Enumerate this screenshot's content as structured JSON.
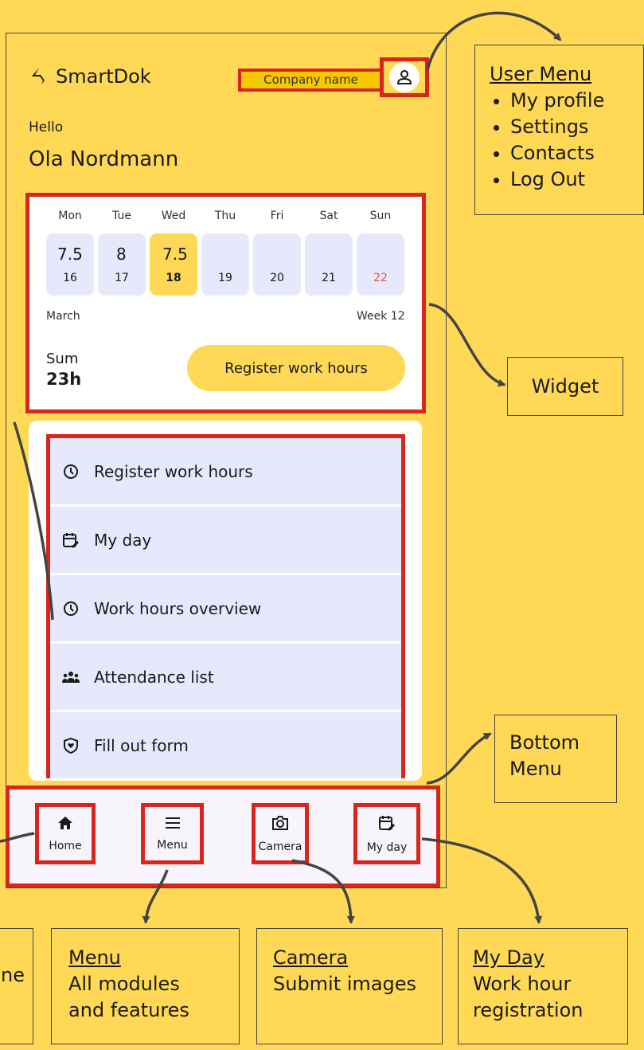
{
  "app": {
    "name": "SmartDok",
    "company": "Company name"
  },
  "greeting": "Hello",
  "user_name": "Ola Nordmann",
  "week": {
    "days": [
      "Mon",
      "Tue",
      "Wed",
      "Thu",
      "Fri",
      "Sat",
      "Sun"
    ],
    "hours": [
      "7.5",
      "8",
      "7.5",
      "",
      "",
      "",
      ""
    ],
    "dates": [
      "16",
      "17",
      "18",
      "19",
      "20",
      "21",
      "22"
    ],
    "month": "March",
    "week_label": "Week 12",
    "sum_label": "Sum",
    "sum_value": "23h",
    "register_button": "Register work hours"
  },
  "modules": [
    {
      "label": "Register work hours",
      "icon": "clock-icon"
    },
    {
      "label": "My day",
      "icon": "calendar-edit-icon"
    },
    {
      "label": "Work hours overview",
      "icon": "clock-icon"
    },
    {
      "label": "Attendance list",
      "icon": "group-icon"
    },
    {
      "label": "Fill out form",
      "icon": "shield-icon"
    }
  ],
  "bottom_nav": [
    {
      "label": "Home",
      "icon": "home-icon"
    },
    {
      "label": "Menu",
      "icon": "menu-icon"
    },
    {
      "label": "Camera",
      "icon": "camera-icon"
    },
    {
      "label": "My day",
      "icon": "calendar-edit-icon"
    }
  ],
  "annotations": {
    "user_menu": {
      "title": "User Menu",
      "items": [
        "My profile",
        "Settings",
        "Contacts",
        "Log Out"
      ]
    },
    "widget": "Widget",
    "bottom_menu": [
      "Bottom",
      "Menu"
    ],
    "home_partial": "ne",
    "menu": {
      "title": "Menu",
      "lines": [
        "All modules",
        "and features"
      ]
    },
    "camera": {
      "title": "Camera",
      "lines": [
        "Submit images"
      ]
    },
    "my_day": {
      "title": "My Day",
      "lines": [
        "Work hour",
        "registration"
      ]
    }
  },
  "colors": {
    "background": "#FFD955",
    "highlight_red": "#D9261C",
    "cell": "#E6E8FB",
    "weekend_red": "#E45B4A"
  }
}
